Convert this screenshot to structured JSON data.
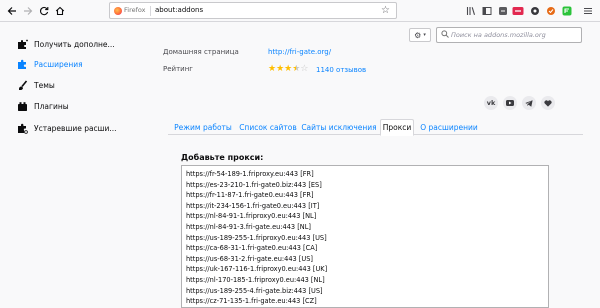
{
  "browser": {
    "identity_label": "Firefox",
    "url": "about:addons"
  },
  "sidebar": {
    "items": [
      {
        "label": "Получить дополне...",
        "icon": "puzzle-dots-icon",
        "selected": false
      },
      {
        "label": "Расширения",
        "icon": "puzzle-icon",
        "selected": true
      },
      {
        "label": "Темы",
        "icon": "brush-icon",
        "selected": false
      },
      {
        "label": "Плагины",
        "icon": "plugin-icon",
        "selected": false
      },
      {
        "label": "Устаревшие расши...",
        "icon": "legacy-puzzle-icon",
        "selected": false
      }
    ]
  },
  "search": {
    "placeholder": "Поиск на addons.mozilla.org"
  },
  "details": {
    "homepage_label": "Домашняя страница",
    "homepage_value": "http://fri-gate.org/",
    "rating_label": "Рейтинг",
    "rating_value": 3.5,
    "reviews_link": "1140 отзывов"
  },
  "social": [
    "vk",
    "youtube",
    "telegram",
    "heart"
  ],
  "tabs": [
    {
      "label": "Режим работы",
      "active": false
    },
    {
      "label": "Список сайтов",
      "active": false
    },
    {
      "label": "Сайты исключения",
      "active": false
    },
    {
      "label": "Прокси",
      "active": true
    },
    {
      "label": "О расширении",
      "active": false
    }
  ],
  "proxy": {
    "heading": "Добавьте прокси:",
    "lines": [
      "https://fr-54-189-1.friproxy.eu:443 [FR]",
      "https://es-23-210-1.fri-gate0.biz:443 [ES]",
      "https://fr-11-87-1.fri-gate0.eu:443 [FR]",
      "https://it-234-156-1.fri-gate0.eu:443 [IT]",
      "https://nl-84-91-1.friproxy0.eu:443 [NL]",
      "https://nl-84-91-3.fri-gate.eu:443 [NL]",
      "https://us-189-255-1.friproxy0.eu:443 [US]",
      "https://ca-68-31-1.fri-gate0.eu:443 [CA]",
      "https://us-68-31-2.fri-gate.eu:443 [US]",
      "https://uk-167-116-1.friproxy0.eu:443 [UK]",
      "https://nl-170-185-1.friproxy0.eu:443 [NL]",
      "https://us-189-255-4.fri-gate.biz:443 [US]",
      "https://cz-71-135-1.fri-gate.eu:443 [CZ]"
    ]
  },
  "colors": {
    "accent": "#0a84ff",
    "star": "#ffbe00",
    "toolbar_badge_red": "#e22850",
    "toolbar_badge_green": "#2ac33a"
  }
}
